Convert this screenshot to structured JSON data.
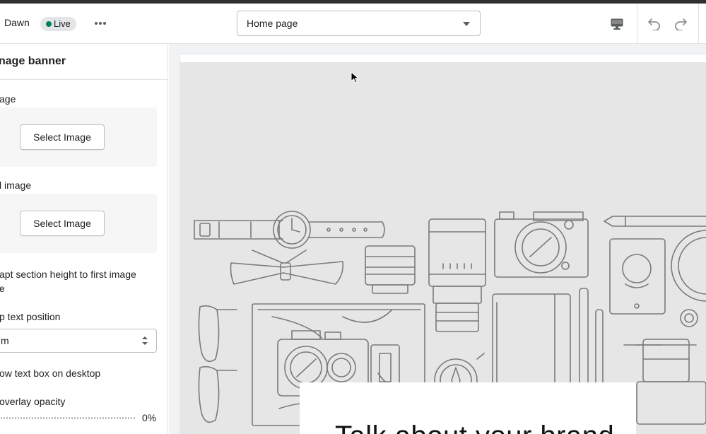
{
  "topbar": {
    "theme_name": "Dawn",
    "live_badge": "Live",
    "page_select": "Home page"
  },
  "sidebar": {
    "section_title": "nage banner",
    "image_label": "age",
    "image_button": "Select Image",
    "second_image_label": "l image",
    "second_image_button": "Select Image",
    "adapt_label_line1": "apt section height to first image",
    "adapt_label_line2": "e",
    "desktop_position_label": "p text position",
    "desktop_position_value": "m",
    "show_textbox_label": "ow text box on desktop",
    "overlay_label": "overlay opacity",
    "overlay_value": "0%"
  },
  "preview": {
    "banner_heading": "Talk about your brand"
  },
  "colors": {
    "live_dot": "#007f5f",
    "banner_bg": "#e6e6e6",
    "line_art": "#7a7a7a"
  }
}
